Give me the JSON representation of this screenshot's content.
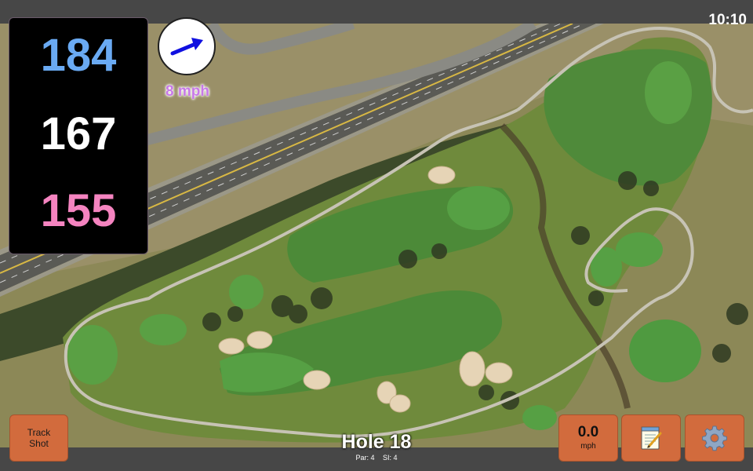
{
  "status": {
    "time": "10:10"
  },
  "distances": {
    "back": "184",
    "center": "167",
    "front": "155"
  },
  "wind": {
    "label": "8 mph"
  },
  "hole": {
    "title": "Hole 18",
    "par": "Par: 4",
    "si": "SI: 4"
  },
  "buttons": {
    "track_shot_line1": "Track",
    "track_shot_line2": "Shot",
    "speed_value": "0.0",
    "speed_unit": "mph",
    "notes_icon": "notepad-icon",
    "settings_icon": "gear-icon"
  },
  "colors": {
    "back": "#6aaaf3",
    "center": "#ffffff",
    "front": "#f584c0",
    "wind": "#c879e8",
    "button": "#d26b3d",
    "wind_arrow": "#1010e0"
  }
}
